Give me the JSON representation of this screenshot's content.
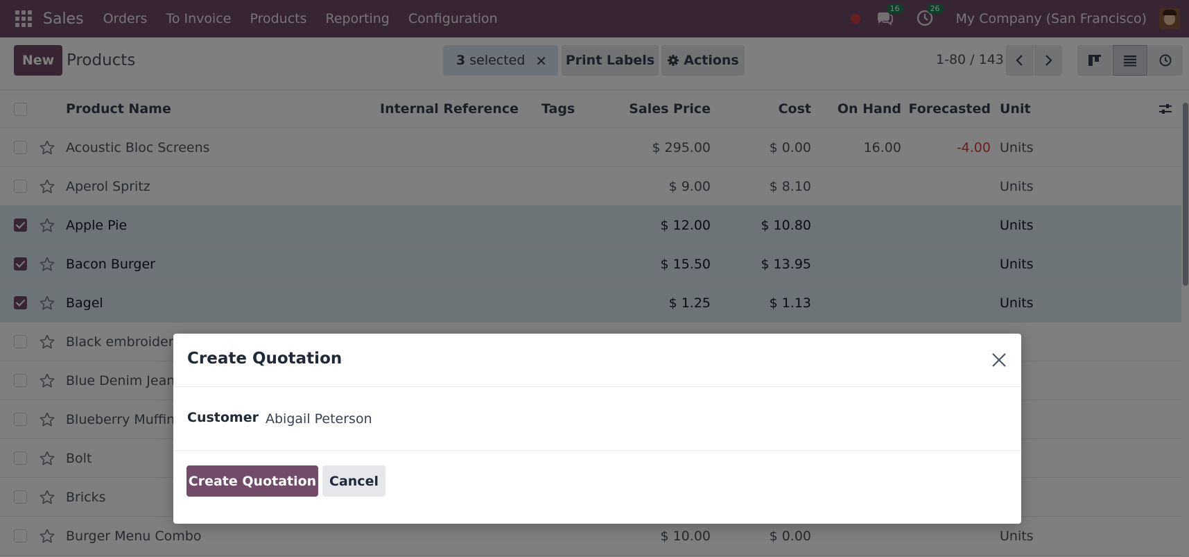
{
  "navbar": {
    "app_name": "Sales",
    "menu": [
      "Orders",
      "To Invoice",
      "Products",
      "Reporting",
      "Configuration"
    ],
    "messages_badge": "16",
    "activities_badge": "26",
    "company": "My Company (San Francisco)",
    "icons": [
      "apps-grid-icon",
      "recording-dot-icon",
      "chat-icon",
      "clock-icon",
      "avatar"
    ]
  },
  "control": {
    "new_label": "New",
    "title": "Products",
    "selected_count": "3",
    "selected_word": "selected",
    "clear_icon": "✕",
    "print_labels": "Print Labels",
    "actions": "Actions",
    "pager": "1-80 / 143"
  },
  "table": {
    "headers": {
      "name": "Product Name",
      "ref": "Internal Reference",
      "tags": "Tags",
      "price": "Sales Price",
      "cost": "Cost",
      "onhand": "On Hand",
      "fore": "Forecasted",
      "unit": "Unit"
    },
    "rows": [
      {
        "name": "Acoustic Bloc Screens",
        "price": "$ 295.00",
        "cost": "$ 0.00",
        "onhand": "16.00",
        "fore": "-4.00",
        "unit": "Units",
        "selected": false
      },
      {
        "name": "Aperol Spritz",
        "price": "$ 9.00",
        "cost": "$ 8.10",
        "onhand": "",
        "fore": "",
        "unit": "Units",
        "selected": false
      },
      {
        "name": "Apple Pie",
        "price": "$ 12.00",
        "cost": "$ 10.80",
        "onhand": "",
        "fore": "",
        "unit": "Units",
        "selected": true
      },
      {
        "name": "Bacon Burger",
        "price": "$ 15.50",
        "cost": "$ 13.95",
        "onhand": "",
        "fore": "",
        "unit": "Units",
        "selected": true
      },
      {
        "name": "Bagel",
        "price": "$ 1.25",
        "cost": "$ 1.13",
        "onhand": "",
        "fore": "",
        "unit": "Units",
        "selected": true
      },
      {
        "name": "Black embroidere",
        "price": "",
        "cost": "",
        "onhand": "",
        "fore": "",
        "unit": "",
        "selected": false
      },
      {
        "name": "Blue Denim Jeans",
        "price": "",
        "cost": "",
        "onhand": "",
        "fore": "",
        "unit": "",
        "selected": false
      },
      {
        "name": "Blueberry Muffin",
        "price": "",
        "cost": "",
        "onhand": "",
        "fore": "",
        "unit": "",
        "selected": false
      },
      {
        "name": "Bolt",
        "price": "",
        "cost": "",
        "onhand": "",
        "fore": "",
        "unit": "",
        "selected": false
      },
      {
        "name": "Bricks",
        "price": "",
        "cost": "",
        "onhand": "",
        "fore": "",
        "unit": "",
        "selected": false
      },
      {
        "name": "Burger Menu Combo",
        "price": "$ 10.00",
        "cost": "$ 0.00",
        "onhand": "",
        "fore": "",
        "unit": "Units",
        "selected": false
      }
    ]
  },
  "dialog": {
    "title": "Create Quotation",
    "customer_label": "Customer",
    "customer_value": "Abigail Peterson",
    "primary_label": "Create Quotation",
    "cancel_label": "Cancel"
  },
  "colors": {
    "brand": "#714b67",
    "selected_row": "#dbe9ef",
    "negative": "#d23f3a",
    "badge": "#1a7f52"
  }
}
